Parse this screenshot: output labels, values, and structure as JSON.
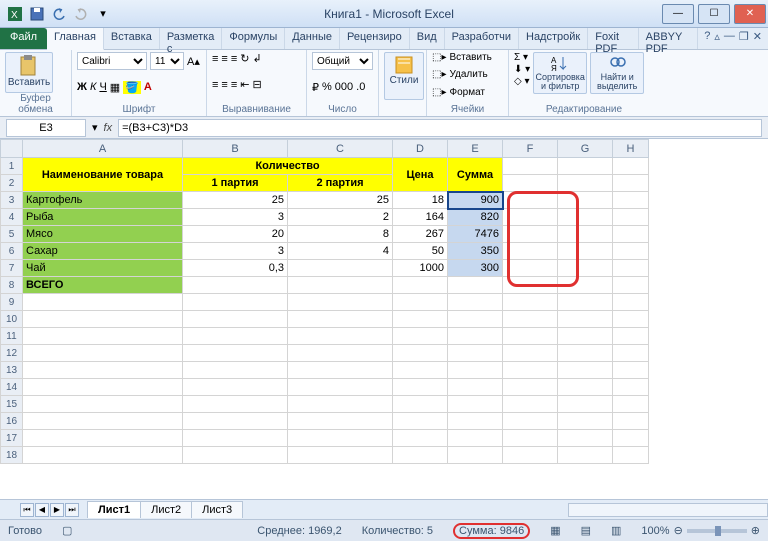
{
  "titlebar": {
    "title": "Книга1 - Microsoft Excel"
  },
  "tabs": {
    "file": "Файл",
    "items": [
      "Главная",
      "Вставка",
      "Разметка с",
      "Формулы",
      "Данные",
      "Рецензиро",
      "Вид",
      "Разработчи",
      "Надстройк",
      "Foxit PDF",
      "ABBYY PDF"
    ],
    "activeIndex": 0
  },
  "groups": {
    "clipboard": {
      "paste": "Вставить",
      "label": "Буфер обмена"
    },
    "font": {
      "name": "Calibri",
      "size": "11",
      "label": "Шрифт"
    },
    "align": {
      "label": "Выравнивание"
    },
    "number": {
      "format": "Общий",
      "label": "Число"
    },
    "styles": {
      "btn": "Стили"
    },
    "cells": {
      "insert": "Вставить",
      "delete": "Удалить",
      "format": "Формат",
      "label": "Ячейки"
    },
    "editing": {
      "sort": "Сортировка и фильтр",
      "find": "Найти и выделить",
      "label": "Редактирование"
    }
  },
  "fbar": {
    "name": "E3",
    "formula": "=(B3+C3)*D3"
  },
  "headers": {
    "cols": [
      "A",
      "B",
      "C",
      "D",
      "E",
      "F",
      "G",
      "H"
    ],
    "merge_qty": "Количество",
    "name": "Наименование товара",
    "p1": "1 партия",
    "p2": "2 партия",
    "price": "Цена",
    "sum": "Сумма",
    "total": "ВСЕГО"
  },
  "rows": [
    {
      "n": "3",
      "name": "Картофель",
      "b": "25",
      "c": "25",
      "d": "18",
      "e": "900"
    },
    {
      "n": "4",
      "name": "Рыба",
      "b": "3",
      "c": "2",
      "d": "164",
      "e": "820"
    },
    {
      "n": "5",
      "name": "Мясо",
      "b": "20",
      "c": "8",
      "d": "267",
      "e": "7476"
    },
    {
      "n": "6",
      "name": "Сахар",
      "b": "3",
      "c": "4",
      "d": "50",
      "e": "350"
    },
    {
      "n": "7",
      "name": "Чай",
      "b": "0,3",
      "c": "",
      "d": "1000",
      "e": "300"
    }
  ],
  "sheets": {
    "items": [
      "Лист1",
      "Лист2",
      "Лист3"
    ],
    "activeIndex": 0
  },
  "status": {
    "ready": "Готово",
    "avg": "Среднее: 1969,2",
    "count": "Количество: 5",
    "sum": "Сумма: 9846",
    "zoom": "100%"
  }
}
